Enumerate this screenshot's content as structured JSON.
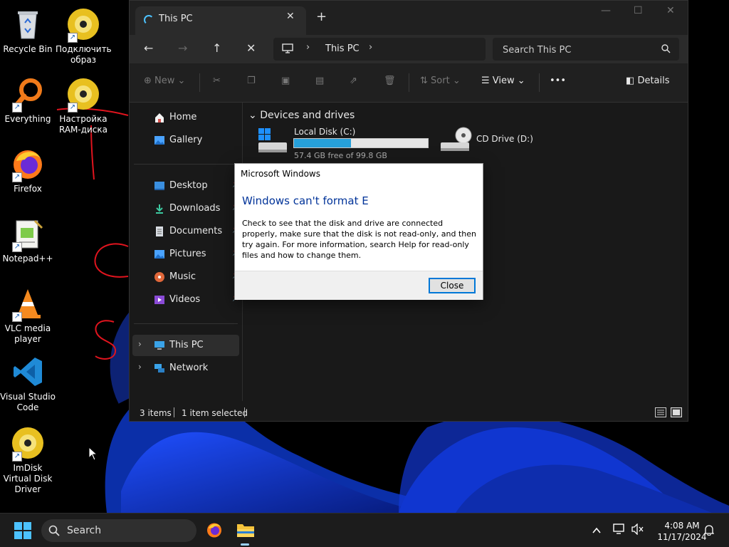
{
  "desktop": {
    "icons": [
      {
        "label": "Recycle Bin",
        "icon": "recycle-bin-icon"
      },
      {
        "label": "Подключить образ",
        "icon": "disc-shortcut-icon"
      },
      {
        "label": "Everything",
        "icon": "everything-search-icon"
      },
      {
        "label": "Настройка RAM-диска",
        "icon": "disc-shortcut-icon"
      },
      {
        "label": "Firefox",
        "icon": "firefox-icon"
      },
      {
        "label": "Notepad++",
        "icon": "notepad-plus-plus-icon"
      },
      {
        "label": "VLC media player",
        "icon": "vlc-icon"
      },
      {
        "label": "Visual Studio Code",
        "icon": "vscode-icon"
      },
      {
        "label": "ImDisk Virtual Disk Driver",
        "icon": "disc-shortcut-icon"
      }
    ],
    "annotation_color": "#e0141e"
  },
  "explorer": {
    "tab_title": "This PC",
    "breadcrumb": "This PC",
    "search_placeholder": "Search This PC",
    "toolbar": {
      "new_label": "New",
      "sort_label": "Sort",
      "view_label": "View",
      "details_label": "Details"
    },
    "sidebar": {
      "home": "Home",
      "gallery": "Gallery",
      "quick": [
        "Desktop",
        "Downloads",
        "Documents",
        "Pictures",
        "Music",
        "Videos"
      ],
      "this_pc": "This PC",
      "network": "Network"
    },
    "group_header": "Devices and drives",
    "drives": [
      {
        "name": "Local Disk (C:)",
        "free_text": "57.4 GB free of 99.8 GB",
        "used_fraction": 0.425
      },
      {
        "name": "CD Drive (D:)"
      }
    ],
    "status": {
      "items": "3 items",
      "selected": "1 item selected"
    },
    "accent": "#4cc2ff"
  },
  "dialog": {
    "title": "Microsoft Windows",
    "heading": "Windows can't format E",
    "message": "Check to see that the disk and drive are connected properly, make sure that the disk is not read-only, and then try again. For more information, search Help for read-only files and how to change them.",
    "close_label": "Close"
  },
  "taskbar": {
    "search_label": "Search",
    "time": "4:08 AM",
    "date": "11/17/2024"
  }
}
